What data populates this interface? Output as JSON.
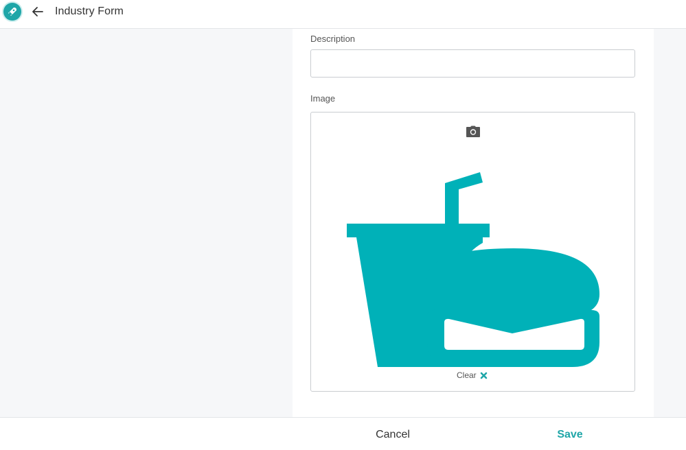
{
  "header": {
    "app_logo_icon": "rocket-icon",
    "back_icon": "arrow-left-icon",
    "title": "Industry Form"
  },
  "form": {
    "description": {
      "label": "Description",
      "value": "",
      "placeholder": ""
    },
    "image": {
      "label": "Image",
      "camera_icon": "camera-icon",
      "image_icon": "fast-food-icon",
      "clear_label": "Clear",
      "clear_icon": "close-icon"
    }
  },
  "footer": {
    "cancel_label": "Cancel",
    "save_label": "Save"
  },
  "colors": {
    "accent": "#1fa6a8",
    "image_fill": "#00b1b8",
    "page_background": "#f6f7f9"
  }
}
